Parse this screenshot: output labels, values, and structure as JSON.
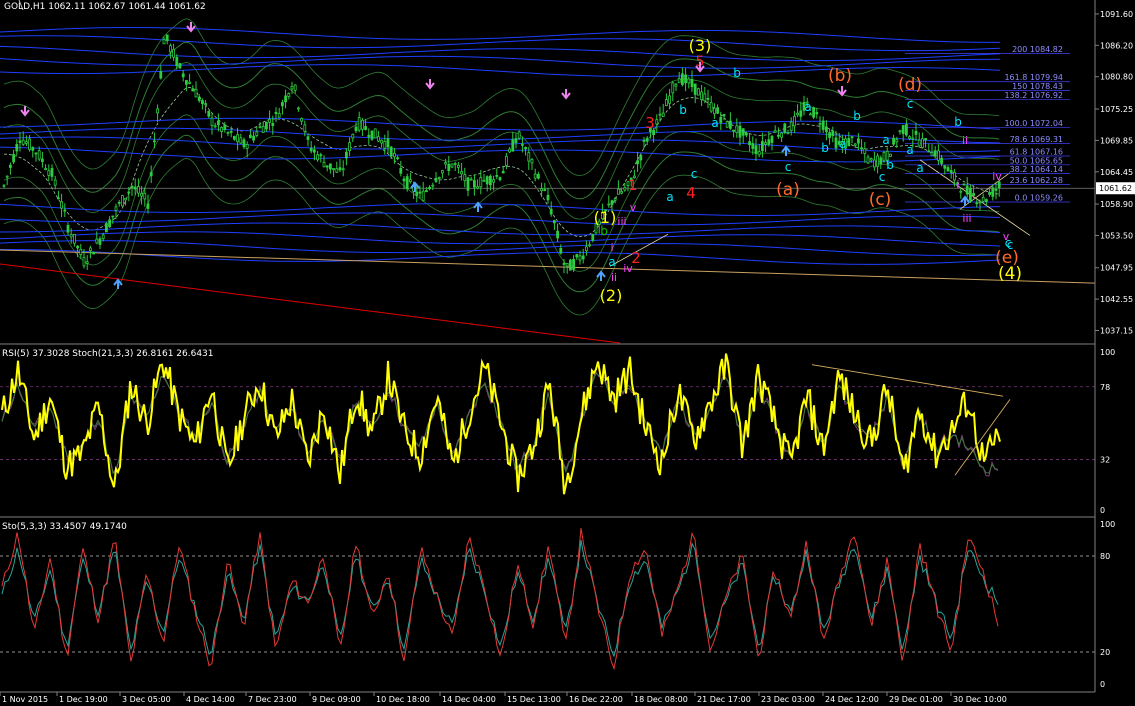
{
  "symbol_header": "GOLD,H1  1062.11 1062.67 1061.44 1061.62",
  "current_price_label": "1061.62",
  "price_axis": {
    "range": [
      1035.0,
      1094.0
    ],
    "ticks": [
      "1091.60",
      "1086.20",
      "1080.80",
      "1075.25",
      "1069.85",
      "1064.45",
      "1058.90",
      "1053.50",
      "1047.95",
      "1042.55",
      "1037.15"
    ]
  },
  "fibonacci": [
    {
      "label": "200 1084.82",
      "price": 1084.82
    },
    {
      "label": "161.8 1079.94",
      "price": 1079.94
    },
    {
      "label": "150 1078.43",
      "price": 1078.43
    },
    {
      "label": "138.2 1076.92",
      "price": 1076.92
    },
    {
      "label": "100.0 1072.04",
      "price": 1072.04
    },
    {
      "label": "78.6 1069.31",
      "price": 1069.31
    },
    {
      "label": "61.8 1067.16",
      "price": 1067.16
    },
    {
      "label": "50.0 1065.65",
      "price": 1065.65
    },
    {
      "label": "38.2 1064.14",
      "price": 1064.14
    },
    {
      "label": "23.6 1062.28",
      "price": 1062.28
    },
    {
      "label": "0.0 1059.26",
      "price": 1059.26
    }
  ],
  "rsi_pane": {
    "title": "RSI(5) 37.3028  Stoch(21,3,3) 26.8161 26.6431",
    "ticks": [
      "100",
      "78",
      "32",
      "0"
    ]
  },
  "stoch_pane": {
    "title": "Sto(5,3,3) 33.4507 49.1740",
    "ticks": [
      "100",
      "80",
      "20",
      "0"
    ]
  },
  "time_axis": [
    "1 Nov 2015",
    "1 Dec 19:00",
    "3 Dec 05:00",
    "4 Dec 14:00",
    "7 Dec 23:00",
    "9 Dec 09:00",
    "10 Dec 18:00",
    "14 Dec 04:00",
    "15 Dec 13:00",
    "16 Dec 22:00",
    "18 Dec 08:00",
    "21 Dec 17:00",
    "23 Dec 03:00",
    "24 Dec 12:00",
    "29 Dec 01:00",
    "30 Dec 10:00"
  ],
  "wave_labels": [
    {
      "text": "(3)",
      "color": "#ffff00"
    },
    {
      "text": "5",
      "color": "#ff2020"
    },
    {
      "text": "(b)",
      "color": "#ff6a2a"
    },
    {
      "text": "(d)",
      "color": "#ff6a2a"
    },
    {
      "text": "3",
      "color": "#ff2020"
    },
    {
      "text": "b",
      "color": "#00e5ff"
    },
    {
      "text": "a",
      "color": "#00e5ff"
    },
    {
      "text": "b",
      "color": "#00e5ff"
    },
    {
      "text": "c",
      "color": "#00e5ff"
    },
    {
      "text": "a",
      "color": "#00e5ff"
    },
    {
      "text": "b",
      "color": "#00e5ff"
    },
    {
      "text": "a",
      "color": "#00e5ff"
    },
    {
      "text": "b",
      "color": "#00e5ff"
    },
    {
      "text": "a",
      "color": "#00e5ff"
    },
    {
      "text": "b",
      "color": "#00e5ff"
    },
    {
      "text": "c",
      "color": "#00e5ff"
    },
    {
      "text": "ii",
      "color": "#ff40ff"
    },
    {
      "text": "c",
      "color": "#00e5ff"
    },
    {
      "text": "1",
      "color": "#ff2020"
    },
    {
      "text": "c",
      "color": "#00e5ff"
    },
    {
      "text": "(a)",
      "color": "#ff6a2a"
    },
    {
      "text": "a",
      "color": "#00e5ff"
    },
    {
      "text": "b",
      "color": "#00e5ff"
    },
    {
      "text": "(c)",
      "color": "#ff6a2a"
    },
    {
      "text": "a",
      "color": "#00e5ff"
    },
    {
      "text": "4",
      "color": "#ff2020"
    },
    {
      "text": "c",
      "color": "#00e5ff"
    },
    {
      "text": "a",
      "color": "#00e5ff"
    },
    {
      "text": "iv",
      "color": "#ff40ff"
    },
    {
      "text": "i",
      "color": "#ff40ff"
    },
    {
      "text": "v",
      "color": "#ff40ff"
    },
    {
      "text": "(1)",
      "color": "#ffff00"
    },
    {
      "text": "iii",
      "color": "#ff40ff"
    },
    {
      "text": "iii",
      "color": "#ff40ff"
    },
    {
      "text": "b",
      "color": "#00c800"
    },
    {
      "text": "a",
      "color": "#00e5ff"
    },
    {
      "text": "v",
      "color": "#ff40ff"
    },
    {
      "text": "c",
      "color": "#00e5ff"
    },
    {
      "text": "2",
      "color": "#ff2020"
    },
    {
      "text": "(e)",
      "color": "#ff6a2a"
    },
    {
      "text": "iv",
      "color": "#ff40ff"
    },
    {
      "text": "ii",
      "color": "#ff40ff"
    },
    {
      "text": "i",
      "color": "#ff40ff"
    },
    {
      "text": "(4)",
      "color": "#ffff00"
    },
    {
      "text": "(2)",
      "color": "#ffff00"
    }
  ],
  "colors": {
    "candles": "#2ecc40",
    "bands_blue": "#1f3fff",
    "envelope_green": "#2e7d32",
    "support_orange": "#c8a060",
    "trend_red": "#e00000",
    "rsi_line": "#ffff00",
    "stoch_main": "#e53935",
    "stoch_signal": "#26a69a",
    "level_line": "#808080",
    "arrow_up": "#4fa3ff",
    "arrow_down": "#ee82ee"
  },
  "chart_data": [
    {
      "type": "line",
      "title": "GOLD,H1",
      "series": [
        {
          "values": [
            1062.0,
            1070.5,
            1068.0,
            1064.0,
            1055.0,
            1049.0,
            1053.0,
            1058.0,
            1062.0,
            1059.0,
            1088.0,
            1082.0,
            1078.0,
            1073.0,
            1071.0,
            1069.0,
            1072.0,
            1074.0,
            1080.0,
            1069.0,
            1066.0,
            1064.0,
            1073.0,
            1071.0,
            1069.0,
            1063.0,
            1060.0,
            1064.0,
            1066.0,
            1062.0,
            1063.0,
            1064.0,
            1071.0,
            1065.0,
            1059.0,
            1047.5,
            1050.0,
            1055.0,
            1060.0,
            1062.0,
            1070.0,
            1074.0,
            1081.0,
            1079.0,
            1076.0,
            1073.0,
            1071.0,
            1068.0,
            1071.0,
            1072.0,
            1076.0,
            1073.0,
            1069.0,
            1070.0,
            1066.0,
            1067.0,
            1072.0,
            1070.0,
            1068.0,
            1064.0,
            1061.0,
            1059.5,
            1062.0
          ]
        }
      ],
      "ylim": [
        1035.0,
        1094.0
      ]
    },
    {
      "type": "line",
      "series": [
        {
          "values": [
            60,
            88,
            45,
            72,
            28,
            35,
            66,
            12,
            80,
            55,
            95,
            60,
            40,
            78,
            25,
            58,
            82,
            45,
            70,
            30,
            65,
            22,
            75,
            48,
            85,
            50,
            35,
            72,
            28,
            62,
            90,
            55,
            20,
            40,
            80,
            15,
            60,
            95,
            70,
            88,
            52,
            30,
            75,
            45,
            68,
            92,
            40,
            85,
            55,
            28,
            72,
            38,
            85,
            60,
            42,
            78,
            22,
            65,
            35,
            50,
            70,
            30,
            48
          ]
        },
        {
          "values": [
            55,
            80,
            50,
            65,
            35,
            40,
            60,
            18,
            72,
            58,
            88,
            62,
            45,
            70,
            30,
            55,
            75,
            50,
            65,
            35,
            60,
            28,
            70,
            50,
            78,
            52,
            40,
            68,
            32,
            60,
            82,
            55,
            25,
            42,
            75,
            20,
            58,
            88,
            68,
            82,
            55,
            35,
            70,
            48,
            65,
            85,
            42,
            78,
            55,
            32,
            68,
            40,
            80,
            58,
            45,
            72,
            28,
            62,
            38,
            48,
            40,
            26,
            27
          ]
        }
      ],
      "ylim": [
        0,
        100
      ]
    },
    {
      "type": "line",
      "series": [
        {
          "values": [
            60,
            95,
            30,
            80,
            15,
            85,
            40,
            92,
            12,
            70,
            25,
            88,
            45,
            10,
            78,
            35,
            94,
            20,
            65,
            50,
            82,
            18,
            90,
            40,
            72,
            12,
            85,
            55,
            28,
            92,
            60,
            15,
            75,
            38,
            88,
            22,
            96,
            48,
            10,
            70,
            85,
            30,
            60,
            95,
            20,
            55,
            80,
            15,
            72,
            40,
            90,
            25,
            65,
            98,
            35,
            78,
            12,
            88,
            50,
            20,
            92,
            70,
            33
          ]
        },
        {
          "values": [
            55,
            85,
            38,
            72,
            22,
            78,
            45,
            85,
            20,
            65,
            32,
            80,
            48,
            18,
            70,
            40,
            86,
            28,
            60,
            52,
            76,
            25,
            82,
            45,
            68,
            20,
            78,
            55,
            35,
            85,
            58,
            22,
            70,
            42,
            80,
            30,
            88,
            50,
            18,
            65,
            78,
            35,
            58,
            88,
            28,
            52,
            75,
            22,
            68,
            44,
            84,
            32,
            62,
            90,
            40,
            72,
            20,
            80,
            52,
            28,
            85,
            66,
            49
          ]
        }
      ],
      "ylim": [
        0,
        100
      ]
    }
  ]
}
